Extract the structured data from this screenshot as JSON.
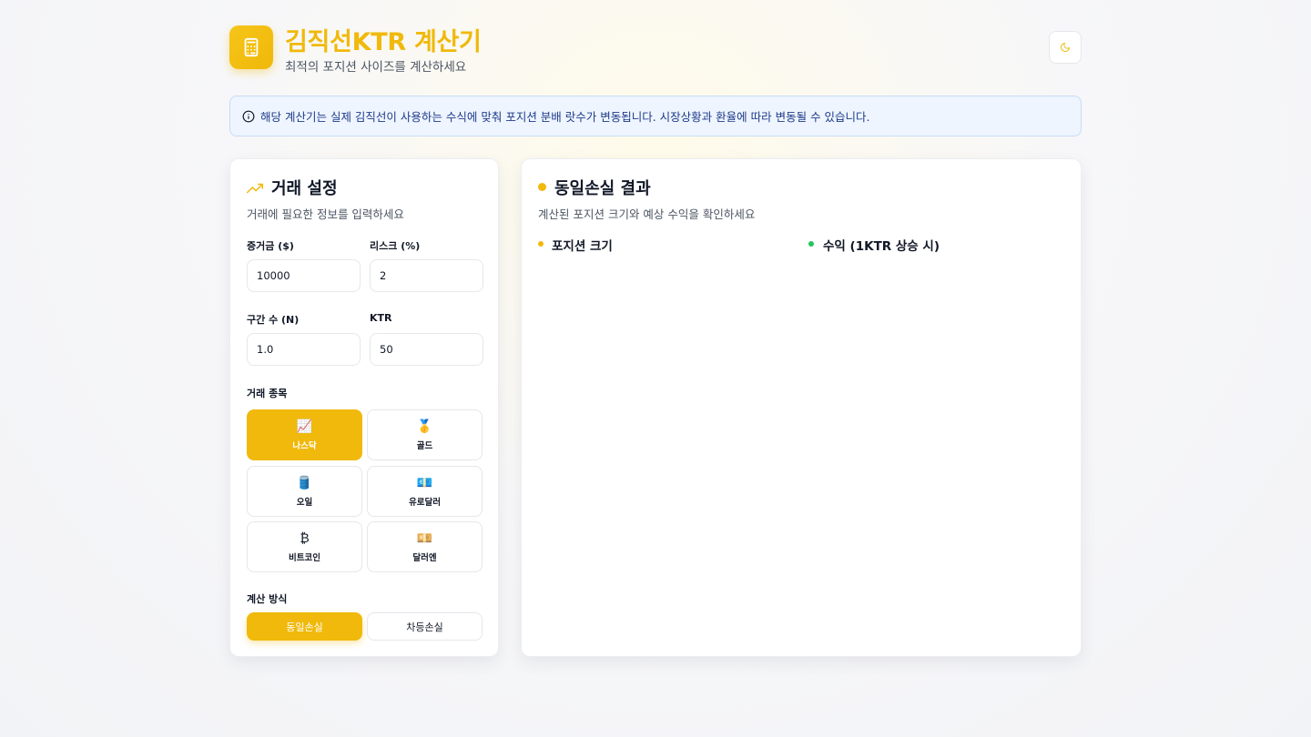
{
  "header": {
    "title": "김직선KTR 계산기",
    "subtitle": "최적의 포지션 사이즈를 계산하세요"
  },
  "notice": {
    "text": "해당 계산기는 실제 김직선이 사용하는 수식에 맞춰 포지션 분배 랏수가 변동됩니다. 시장상황과 환율에 따라 변동될 수 있습니다."
  },
  "settings": {
    "title": "거래 설정",
    "description": "거래에 필요한 정보를 입력하세요",
    "fields": {
      "margin": {
        "label": "증거금 ($)",
        "value": "10000"
      },
      "risk": {
        "label": "리스크 (%)",
        "value": "2"
      },
      "segments": {
        "label": "구간 수 (N)",
        "value": "1.0"
      },
      "ktr": {
        "label": "KTR",
        "value": "50"
      }
    },
    "asset_label": "거래 종목",
    "assets": [
      {
        "icon": "📈",
        "icon_name": "chart-increasing-icon",
        "label": "나스닥",
        "active": true
      },
      {
        "icon": "🥇",
        "icon_name": "gold-medal-icon",
        "label": "골드",
        "active": false
      },
      {
        "icon": "🛢️",
        "icon_name": "oil-drum-icon",
        "label": "오일",
        "active": false
      },
      {
        "icon": "💶",
        "icon_name": "euro-banknote-icon",
        "label": "유로달러",
        "active": false
      },
      {
        "icon": "₿",
        "icon_name": "bitcoin-icon",
        "label": "비트코인",
        "active": false
      },
      {
        "icon": "💴",
        "icon_name": "yen-banknote-icon",
        "label": "달러엔",
        "active": false
      }
    ],
    "method_label": "계산 방식",
    "methods": {
      "equal": "동일손실",
      "differential": "차등손실"
    }
  },
  "result": {
    "title": "동일손실 결과",
    "description": "계산된 포지션 크기와 예상 수익을 확인하세요",
    "position_label": "포지션 크기",
    "profit_label": "수익 (1KTR 상승 시)"
  },
  "colors": {
    "accent": "#f0b90b",
    "success": "#22c55e",
    "notice_bg": "#eef5fe",
    "notice_text": "#1e3a8a"
  }
}
